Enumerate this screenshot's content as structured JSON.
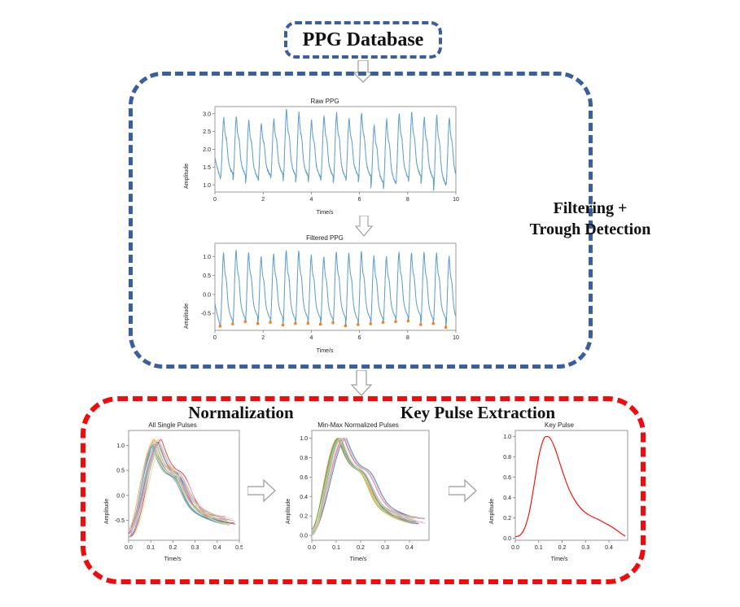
{
  "title_box": {
    "label": "PPG Database"
  },
  "annotations": {
    "filtering": "Filtering +\nTrough Detection",
    "normalization": "Normalization",
    "key_pulse_extraction": "Key Pulse Extraction"
  },
  "arrows": {
    "database_to_pipeline": "down-block-arrow",
    "raw_to_filtered": "down-block-arrow",
    "pipeline_to_extraction": "down-block-arrow",
    "all_to_norm": "right-block-arrow",
    "norm_to_key": "right-block-arrow"
  },
  "colors": {
    "blue_box": "#3a5f9f",
    "red_box": "#f00c0c",
    "signal_blue": "#1f77b4",
    "trough_orange": "#ff7f0e",
    "key_pulse_red": "#ff0000",
    "axis_gray": "#808080"
  },
  "chart_data": [
    {
      "id": "raw_ppg",
      "type": "line",
      "title": "Raw PPG",
      "xlabel": "Time/s",
      "ylabel": "Amplitude",
      "xlim": [
        0,
        10
      ],
      "ylim": [
        0.8,
        3.2
      ],
      "xticks": [
        "0",
        "2",
        "4",
        "6",
        "8",
        "10"
      ],
      "xtick_values": [
        0,
        2,
        4,
        6,
        8,
        10
      ],
      "yticks": [
        "1.0",
        "1.5",
        "2.0",
        "2.5",
        "3.0"
      ],
      "ytick_values": [
        1.0,
        1.5,
        2.0,
        2.5,
        3.0
      ],
      "grid": false,
      "legend": "none",
      "series": [
        {
          "name": "raw ppg",
          "color": "#1f77b4",
          "pulse_count": 19,
          "period": 0.52,
          "baseline": 1.12,
          "peak_amplitudes": [
            2.9,
            2.93,
            2.83,
            2.73,
            2.86,
            3.11,
            3.03,
            2.82,
            2.95,
            3.02,
            2.88,
            3.04,
            2.7,
            2.85,
            3.0,
            3.03,
            2.9,
            2.95,
            2.9
          ],
          "trough_values": [
            1.18,
            1.15,
            1.06,
            1.14,
            1.17,
            1.12,
            1.1,
            1.08,
            1.11,
            1.05,
            1.13,
            1.09,
            0.93,
            0.9,
            1.05,
            1.1,
            1.04,
            0.84,
            1.0
          ],
          "start_value": 1.78
        }
      ]
    },
    {
      "id": "filtered_ppg",
      "type": "line",
      "title": "Filtered PPG",
      "xlabel": "Time/s",
      "ylabel": "Amplitude",
      "xlim": [
        0,
        10
      ],
      "ylim": [
        -0.95,
        1.35
      ],
      "xticks": [
        "0",
        "2",
        "4",
        "6",
        "8",
        "10"
      ],
      "xtick_values": [
        0,
        2,
        4,
        6,
        8,
        10
      ],
      "yticks": [
        "-0.5",
        "0.0",
        "0.5",
        "1.0"
      ],
      "ytick_values": [
        -0.5,
        0.0,
        0.5,
        1.0
      ],
      "grid": false,
      "legend": "none",
      "series": [
        {
          "name": "filtered ppg",
          "color": "#1f77b4",
          "pulse_count": 19,
          "period": 0.52,
          "peak_amplitudes": [
            1.1,
            1.17,
            1.11,
            1.0,
            1.07,
            1.17,
            1.15,
            1.05,
            1.0,
            1.13,
            1.1,
            1.14,
            1.02,
            1.0,
            1.12,
            1.1,
            1.12,
            1.1,
            1.01,
            1.18
          ],
          "trough_values": [
            -0.84,
            -0.78,
            -0.72,
            -0.77,
            -0.74,
            -0.81,
            -0.77,
            -0.76,
            -0.79,
            -0.75,
            -0.83,
            -0.8,
            -0.78,
            -0.74,
            -0.72,
            -0.7,
            -0.8,
            -0.77,
            -0.87,
            -0.8
          ],
          "start_value": -0.24
        },
        {
          "name": "detected troughs",
          "color": "#ff7f0e",
          "marker": "square",
          "count": 19
        }
      ]
    },
    {
      "id": "all_single_pulses",
      "type": "line",
      "title": "All Single Pulses",
      "xlabel": "Time/s",
      "ylabel": "Amplitude",
      "xlim": [
        0,
        0.5
      ],
      "ylim": [
        -0.9,
        1.3
      ],
      "xticks": [
        "0.0",
        "0.1",
        "0.2",
        "0.3",
        "0.4",
        "0.5"
      ],
      "xtick_values": [
        0.0,
        0.1,
        0.2,
        0.3,
        0.4,
        0.5
      ],
      "yticks": [
        "-0.5",
        "0.0",
        "0.5",
        "1.0"
      ],
      "ytick_values": [
        -0.5,
        0.0,
        0.5,
        1.0
      ],
      "grid": false,
      "legend": "none",
      "series_count": 19,
      "series_colors": [
        "#1f77b4",
        "#ff7f0e",
        "#2ca02c",
        "#d62728",
        "#9467bd",
        "#8c564b",
        "#e377c2",
        "#7f7f7f",
        "#bcbd22",
        "#17becf",
        "#aec7e8",
        "#ffbb78",
        "#98df8a",
        "#ff9896",
        "#c5b0d5",
        "#c49c94",
        "#f7b6d2",
        "#dbdb8d",
        "#9edae5"
      ],
      "peak_time": 0.14,
      "peak_amplitude_range": [
        0.97,
        1.13
      ],
      "start_amplitude_range": [
        -0.85,
        -0.68
      ],
      "end_amplitude_range": [
        -0.72,
        -0.42
      ]
    },
    {
      "id": "minmax_normalized_pulses",
      "type": "line",
      "title": "Min-Max Normalized Pulses",
      "xlabel": "Time/s",
      "ylabel": "Amplitude",
      "xlim": [
        0,
        0.48
      ],
      "ylim": [
        -0.05,
        1.08
      ],
      "xticks": [
        "0.0",
        "0.1",
        "0.2",
        "0.3",
        "0.4"
      ],
      "xtick_values": [
        0.0,
        0.1,
        0.2,
        0.3,
        0.4
      ],
      "yticks": [
        "0.0",
        "0.2",
        "0.4",
        "0.6",
        "0.8",
        "1.0"
      ],
      "ytick_values": [
        0.0,
        0.2,
        0.4,
        0.6,
        0.8,
        1.0
      ],
      "grid": false,
      "legend": "none",
      "series_count": 19,
      "series_colors": [
        "#1f77b4",
        "#ff7f0e",
        "#2ca02c",
        "#d62728",
        "#9467bd",
        "#8c564b",
        "#e377c2",
        "#7f7f7f",
        "#bcbd22",
        "#17becf",
        "#aec7e8",
        "#ffbb78",
        "#98df8a",
        "#ff9896",
        "#c5b0d5",
        "#c49c94",
        "#f7b6d2",
        "#dbdb8d",
        "#9edae5"
      ],
      "peak_time": 0.135,
      "peak_amplitude": 1.0,
      "start_amplitude_range": [
        0.0,
        0.06
      ],
      "end_amplitude_range": [
        0.04,
        0.2
      ]
    },
    {
      "id": "key_pulse",
      "type": "line",
      "title": "Key Pulse",
      "xlabel": "Time/s",
      "ylabel": "Amplitude",
      "xlim": [
        0,
        0.48
      ],
      "ylim": [
        -0.02,
        1.06
      ],
      "xticks": [
        "0.0",
        "0.1",
        "0.2",
        "0.3",
        "0.4"
      ],
      "xtick_values": [
        0.0,
        0.1,
        0.2,
        0.3,
        0.4
      ],
      "yticks": [
        "0.0",
        "0.2",
        "0.4",
        "0.6",
        "0.8",
        "1.0"
      ],
      "ytick_values": [
        0.0,
        0.2,
        0.4,
        0.6,
        0.8,
        1.0
      ],
      "grid": false,
      "legend": "none",
      "series": [
        {
          "name": "key pulse",
          "color": "#ff0000",
          "x": [
            0.0,
            0.02,
            0.04,
            0.06,
            0.08,
            0.1,
            0.12,
            0.135,
            0.15,
            0.17,
            0.19,
            0.21,
            0.23,
            0.25,
            0.27,
            0.29,
            0.31,
            0.33,
            0.35,
            0.37,
            0.39,
            0.41,
            0.43,
            0.45,
            0.47
          ],
          "y": [
            0.015,
            0.03,
            0.1,
            0.26,
            0.52,
            0.8,
            0.97,
            1.0,
            0.98,
            0.88,
            0.74,
            0.6,
            0.48,
            0.39,
            0.32,
            0.27,
            0.235,
            0.21,
            0.19,
            0.165,
            0.14,
            0.115,
            0.085,
            0.05,
            0.02
          ]
        }
      ]
    }
  ]
}
